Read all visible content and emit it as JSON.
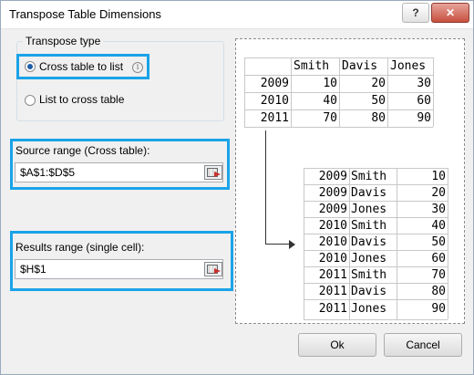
{
  "window": {
    "title": "Transpose Table Dimensions",
    "help_label": "?",
    "close_label": "✕"
  },
  "transpose_type": {
    "legend": "Transpose type",
    "options": [
      {
        "label": "Cross table to list",
        "selected": true
      },
      {
        "label": "List to cross table",
        "selected": false
      }
    ],
    "info_icon": "i"
  },
  "source_range": {
    "label": "Source range (Cross table):",
    "value": "$A$1:$D$5"
  },
  "results_range": {
    "label": "Results range (single cell):",
    "value": "$H$1"
  },
  "preview": {
    "cross_table": {
      "headers": [
        "Smith",
        "Davis",
        "Jones"
      ],
      "rows": [
        {
          "year": "2009",
          "values": [
            "10",
            "20",
            "30"
          ]
        },
        {
          "year": "2010",
          "values": [
            "40",
            "50",
            "60"
          ]
        },
        {
          "year": "2011",
          "values": [
            "70",
            "80",
            "90"
          ]
        }
      ]
    },
    "list": [
      {
        "year": "2009",
        "name": "Smith",
        "value": "10"
      },
      {
        "year": "2009",
        "name": "Davis",
        "value": "20"
      },
      {
        "year": "2009",
        "name": "Jones",
        "value": "30"
      },
      {
        "year": "2010",
        "name": "Smith",
        "value": "40"
      },
      {
        "year": "2010",
        "name": "Davis",
        "value": "50"
      },
      {
        "year": "2010",
        "name": "Jones",
        "value": "60"
      },
      {
        "year": "2011",
        "name": "Smith",
        "value": "70"
      },
      {
        "year": "2011",
        "name": "Davis",
        "value": "80"
      },
      {
        "year": "2011",
        "name": "Jones",
        "value": "90"
      }
    ]
  },
  "buttons": {
    "ok": "Ok",
    "cancel": "Cancel"
  },
  "colors": {
    "highlight": "#1aa3e8"
  }
}
